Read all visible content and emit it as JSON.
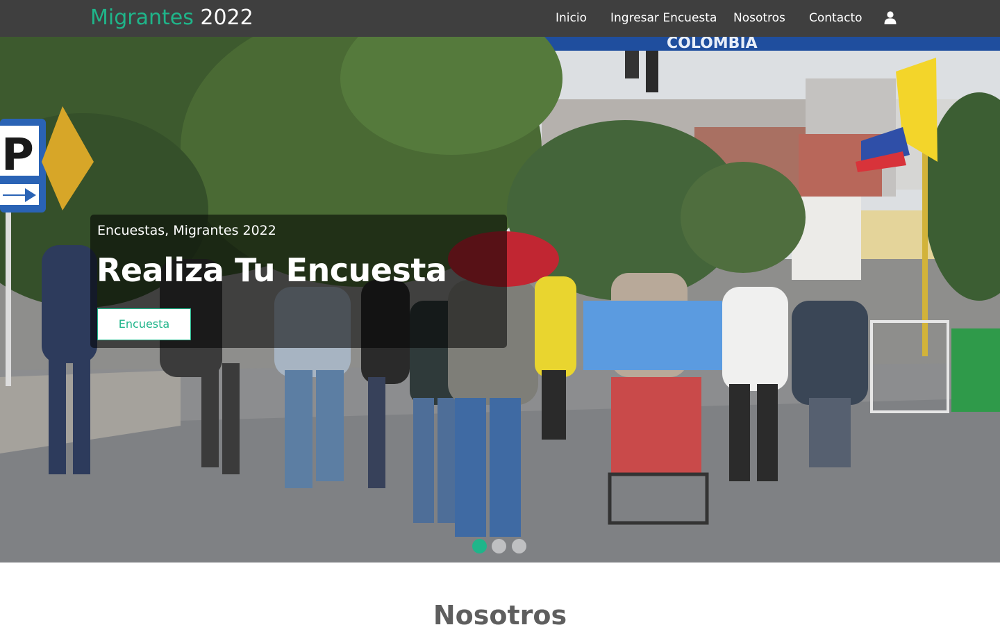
{
  "navbar": {
    "brand_part1": "Migrantes",
    "brand_part2": " 2022",
    "links": [
      "Inicio",
      "Ingresar Encuesta",
      "Nosotros",
      "Contacto"
    ],
    "user_icon": "user-icon"
  },
  "hero": {
    "subtitle": "Encuestas, Migrantes 2022",
    "title": "Realiza Tu Encuesta",
    "button_label": "Encuesta",
    "slides_total": 3,
    "active_slide": 1,
    "sign_text": "COLOMBIA",
    "parking_sign": "P"
  },
  "section": {
    "title": "Nosotros"
  },
  "colors": {
    "accent": "#1fb58a",
    "navbar_bg": "#3f3f3f"
  }
}
